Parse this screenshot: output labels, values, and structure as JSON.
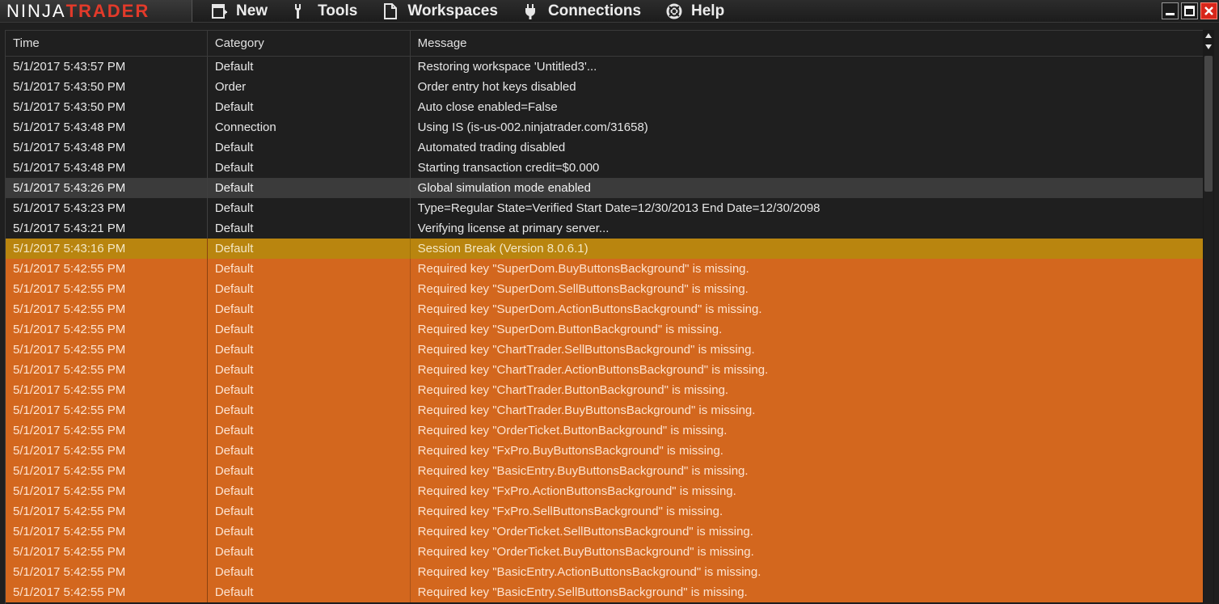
{
  "app": {
    "logo_part1": "NINJA",
    "logo_part2": "TRADER"
  },
  "menu": {
    "new": "New",
    "tools": "Tools",
    "workspaces": "Workspaces",
    "connections": "Connections",
    "help": "Help"
  },
  "icons": {
    "new": "new-window-icon",
    "tools": "wrench-icon",
    "workspaces": "document-icon",
    "connections": "plug-icon",
    "help": "lifebuoy-icon",
    "minimize": "minimize-icon",
    "maximize": "maximize-icon",
    "close": "close-icon"
  },
  "colors": {
    "brand_red": "#e23a2a",
    "session_break": "#b9850f",
    "warning": "#d3671e",
    "selected": "#3b3b3b",
    "background": "#1f1f1f"
  },
  "grid": {
    "columns": [
      "Time",
      "Category",
      "Message"
    ],
    "rows": [
      {
        "time": "5/1/2017 5:43:57 PM",
        "category": "Default",
        "message": "Restoring workspace 'Untitled3'...",
        "style": "default"
      },
      {
        "time": "5/1/2017 5:43:50 PM",
        "category": "Order",
        "message": "Order entry hot keys disabled",
        "style": "default"
      },
      {
        "time": "5/1/2017 5:43:50 PM",
        "category": "Default",
        "message": "Auto close enabled=False",
        "style": "default"
      },
      {
        "time": "5/1/2017 5:43:48 PM",
        "category": "Connection",
        "message": "Using IS (is-us-002.ninjatrader.com/31658)",
        "style": "default"
      },
      {
        "time": "5/1/2017 5:43:48 PM",
        "category": "Default",
        "message": "Automated trading disabled",
        "style": "default"
      },
      {
        "time": "5/1/2017 5:43:48 PM",
        "category": "Default",
        "message": "Starting transaction credit=$0.000",
        "style": "default"
      },
      {
        "time": "5/1/2017 5:43:26 PM",
        "category": "Default",
        "message": "Global simulation mode enabled",
        "style": "selected"
      },
      {
        "time": "5/1/2017 5:43:23 PM",
        "category": "Default",
        "message": "Type=Regular State=Verified Start Date=12/30/2013 End Date=12/30/2098",
        "style": "default"
      },
      {
        "time": "5/1/2017 5:43:21 PM",
        "category": "Default",
        "message": "Verifying license at primary server...",
        "style": "default"
      },
      {
        "time": "5/1/2017 5:43:16 PM",
        "category": "Default",
        "message": "Session Break (Version 8.0.6.1)",
        "style": "session"
      },
      {
        "time": "5/1/2017 5:42:55 PM",
        "category": "Default",
        "message": "Required key \"SuperDom.BuyButtonsBackground\" is missing.",
        "style": "warning"
      },
      {
        "time": "5/1/2017 5:42:55 PM",
        "category": "Default",
        "message": "Required key \"SuperDom.SellButtonsBackground\" is missing.",
        "style": "warning"
      },
      {
        "time": "5/1/2017 5:42:55 PM",
        "category": "Default",
        "message": "Required key \"SuperDom.ActionButtonsBackground\" is missing.",
        "style": "warning"
      },
      {
        "time": "5/1/2017 5:42:55 PM",
        "category": "Default",
        "message": "Required key \"SuperDom.ButtonBackground\" is missing.",
        "style": "warning"
      },
      {
        "time": "5/1/2017 5:42:55 PM",
        "category": "Default",
        "message": "Required key \"ChartTrader.SellButtonsBackground\" is missing.",
        "style": "warning"
      },
      {
        "time": "5/1/2017 5:42:55 PM",
        "category": "Default",
        "message": "Required key \"ChartTrader.ActionButtonsBackground\" is missing.",
        "style": "warning"
      },
      {
        "time": "5/1/2017 5:42:55 PM",
        "category": "Default",
        "message": "Required key \"ChartTrader.ButtonBackground\" is missing.",
        "style": "warning"
      },
      {
        "time": "5/1/2017 5:42:55 PM",
        "category": "Default",
        "message": "Required key \"ChartTrader.BuyButtonsBackground\" is missing.",
        "style": "warning"
      },
      {
        "time": "5/1/2017 5:42:55 PM",
        "category": "Default",
        "message": "Required key \"OrderTicket.ButtonBackground\" is missing.",
        "style": "warning"
      },
      {
        "time": "5/1/2017 5:42:55 PM",
        "category": "Default",
        "message": "Required key \"FxPro.BuyButtonsBackground\" is missing.",
        "style": "warning"
      },
      {
        "time": "5/1/2017 5:42:55 PM",
        "category": "Default",
        "message": "Required key \"BasicEntry.BuyButtonsBackground\" is missing.",
        "style": "warning"
      },
      {
        "time": "5/1/2017 5:42:55 PM",
        "category": "Default",
        "message": "Required key \"FxPro.ActionButtonsBackground\" is missing.",
        "style": "warning"
      },
      {
        "time": "5/1/2017 5:42:55 PM",
        "category": "Default",
        "message": "Required key \"FxPro.SellButtonsBackground\" is missing.",
        "style": "warning"
      },
      {
        "time": "5/1/2017 5:42:55 PM",
        "category": "Default",
        "message": "Required key \"OrderTicket.SellButtonsBackground\" is missing.",
        "style": "warning"
      },
      {
        "time": "5/1/2017 5:42:55 PM",
        "category": "Default",
        "message": "Required key \"OrderTicket.BuyButtonsBackground\" is missing.",
        "style": "warning"
      },
      {
        "time": "5/1/2017 5:42:55 PM",
        "category": "Default",
        "message": "Required key \"BasicEntry.ActionButtonsBackground\" is missing.",
        "style": "warning"
      },
      {
        "time": "5/1/2017 5:42:55 PM",
        "category": "Default",
        "message": "Required key \"BasicEntry.SellButtonsBackground\" is missing.",
        "style": "warning"
      }
    ]
  }
}
